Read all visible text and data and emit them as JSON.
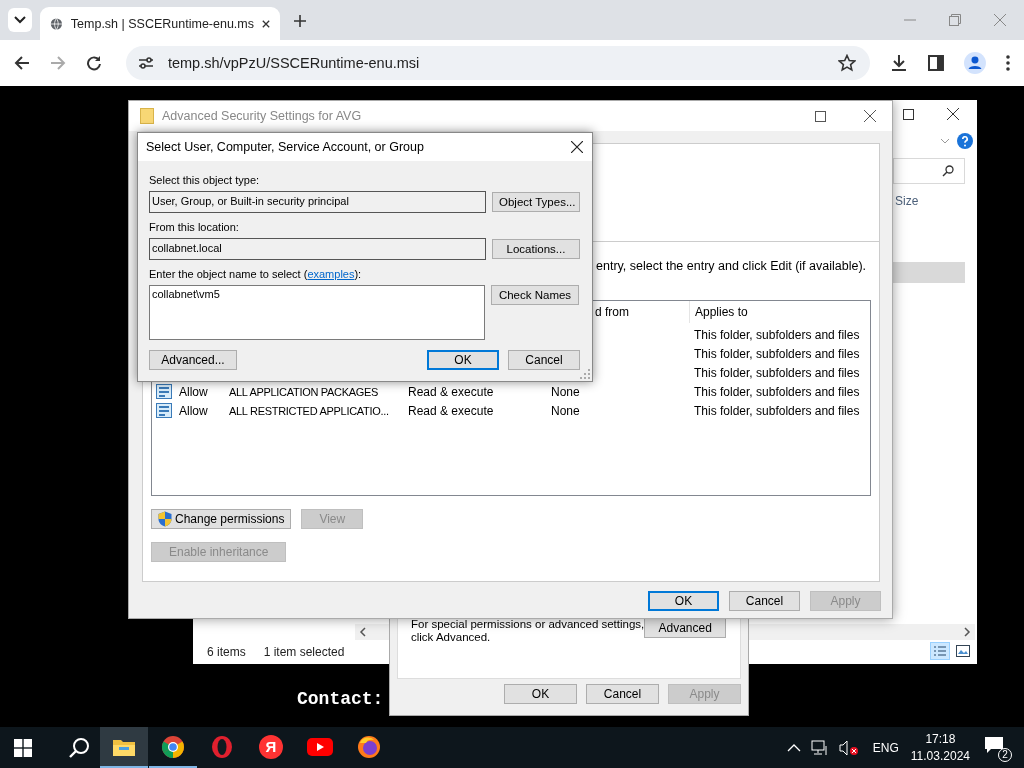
{
  "browser": {
    "tab_title": "Temp.sh | SSCERuntime-enu.ms",
    "url": "temp.sh/vpPzU/SSCERuntime-enu.msi"
  },
  "explorer": {
    "column": "Size",
    "status": [
      "6 items",
      "1 item selected"
    ]
  },
  "properties": {
    "note": [
      "For special permissions or advanced settings,",
      "click Advanced."
    ],
    "advanced_button": {
      "label": "Advanced",
      "disabled": false,
      "default": false
    },
    "buttons": [
      {
        "label": "OK",
        "disabled": false,
        "default": false
      },
      {
        "label": "Cancel",
        "disabled": false,
        "default": false
      },
      {
        "label": "Apply",
        "disabled": true,
        "default": false
      }
    ]
  },
  "advanced_security": {
    "title": "Advanced Security Settings for AVG",
    "active": false,
    "instruction": "entry, select the entry and click Edit (if available).",
    "columns": [
      "d from",
      "Applies to"
    ],
    "rows": [
      {
        "applies_to": "This folder, subfolders and files"
      },
      {
        "applies_to": "This folder, subfolders and files"
      },
      {
        "applies_to": "This folder, subfolders and files"
      },
      {
        "type": "Allow",
        "principal": "ALL APPLICATION PACKAGES",
        "access": "Read & execute",
        "inherited": "None",
        "applies_to": "This folder, subfolders and files"
      },
      {
        "type": "Allow",
        "principal": "ALL RESTRICTED APPLICATIO...",
        "access": "Read & execute",
        "inherited": "None",
        "applies_to": "This folder, subfolders and files"
      }
    ],
    "actions": [
      [
        {
          "label": "Change permissions",
          "disabled": false,
          "default": false,
          "shield": true
        },
        {
          "label": "View",
          "disabled": true,
          "default": false
        }
      ],
      [
        {
          "label": "Enable inheritance",
          "disabled": true,
          "default": false
        }
      ]
    ],
    "buttons": [
      {
        "label": "OK",
        "disabled": false,
        "default": true
      },
      {
        "label": "Cancel",
        "disabled": false,
        "default": false
      },
      {
        "label": "Apply",
        "disabled": true,
        "default": false
      }
    ]
  },
  "select_dialog": {
    "title": "Select User, Computer, Service Account, or Group",
    "type_label": "Select this object type:",
    "type_value": "User, Group, or Built-in security principal",
    "type_button": {
      "label": "Object Types...",
      "disabled": false,
      "default": false
    },
    "location_label": "From this location:",
    "location_value": "collabnet.local",
    "location_button": {
      "label": "Locations...",
      "disabled": false,
      "default": false
    },
    "name_label": "Enter the object name to select (",
    "name_link": "examples",
    "name_label_end": "):",
    "name_value": "collabnet\\vm5",
    "check_button": {
      "label": "Check Names",
      "disabled": false,
      "default": false
    },
    "advanced_button": {
      "label": "Advanced...",
      "disabled": false,
      "default": false
    },
    "buttons": [
      {
        "label": "OK",
        "disabled": false,
        "default": true
      },
      {
        "label": "Cancel",
        "disabled": false,
        "default": false
      }
    ]
  },
  "desktop_text": "Contact:",
  "taskbar": {
    "apps": [
      {
        "kind": "explorer",
        "selected": true,
        "running": true
      },
      {
        "kind": "chrome",
        "selected": false,
        "running": true
      },
      {
        "kind": "opera",
        "selected": false,
        "running": false
      },
      {
        "kind": "yandex",
        "selected": false,
        "running": false,
        "glyph": "Я"
      },
      {
        "kind": "youtube",
        "selected": false,
        "running": false
      },
      {
        "kind": "firefox",
        "selected": false,
        "running": false
      }
    ],
    "language": "ENG",
    "time": "17:18",
    "date": "11.03.2024",
    "notifications": "2"
  }
}
